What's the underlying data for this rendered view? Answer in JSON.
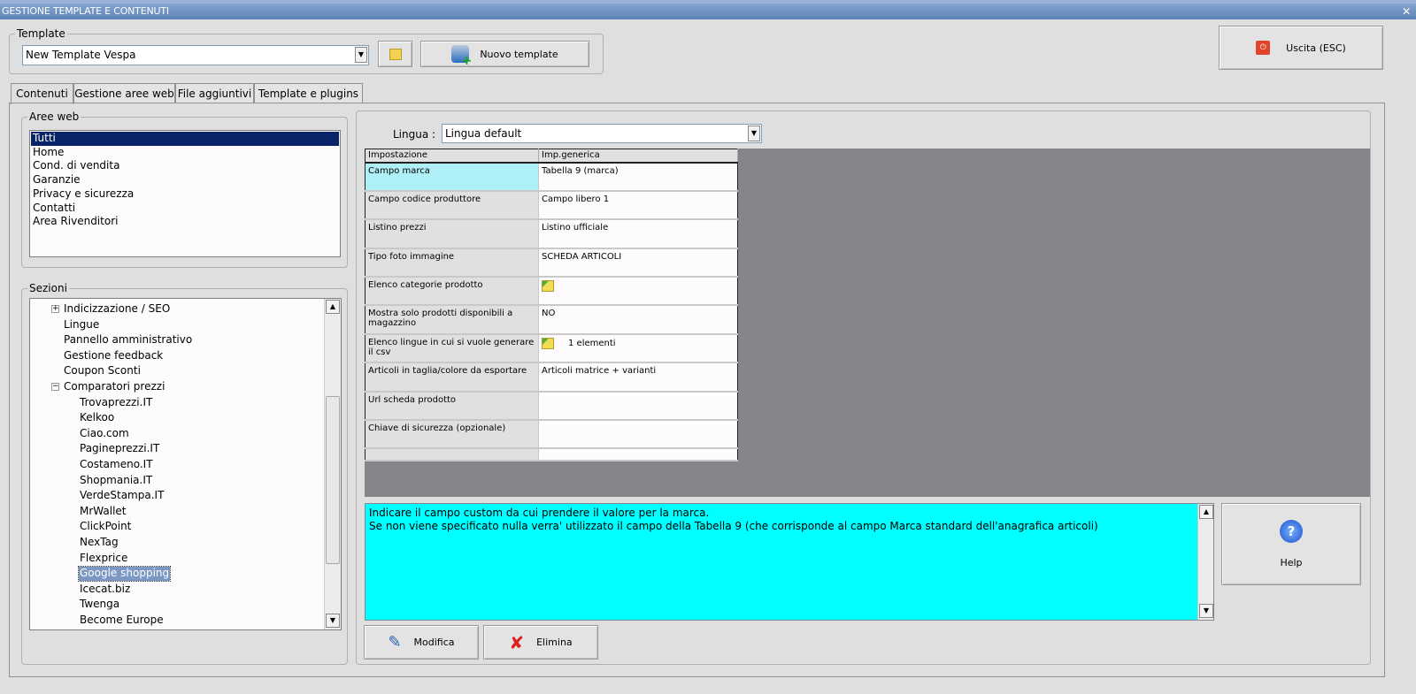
{
  "window": {
    "title": "GESTIONE TEMPLATE E CONTENUTI"
  },
  "template": {
    "group_label": "Template",
    "selected": "New Template Vespa",
    "new_button": "Nuovo template"
  },
  "exit_button": "Uscita (ESC)",
  "tabs": [
    {
      "label": "Contenuti"
    },
    {
      "label": "Gestione aree web"
    },
    {
      "label": "File aggiuntivi"
    },
    {
      "label": "Template e plugins"
    }
  ],
  "aree_web": {
    "label": "Aree web",
    "items": [
      "Tutti",
      "Home",
      "Cond. di vendita",
      "Garanzie",
      "Privacy e sicurezza",
      "Contatti",
      "Area Rivenditori"
    ],
    "selected": "Tutti"
  },
  "sezioni": {
    "label": "Sezioni",
    "items": [
      {
        "label": "Indicizzazione / SEO",
        "level": 1,
        "expander": "+"
      },
      {
        "label": "Lingue",
        "level": 1
      },
      {
        "label": "Pannello amministrativo",
        "level": 1
      },
      {
        "label": "Gestione feedback",
        "level": 1
      },
      {
        "label": "Coupon Sconti",
        "level": 1
      },
      {
        "label": "Comparatori prezzi",
        "level": 1,
        "expander": "−"
      },
      {
        "label": "Trovaprezzi.IT",
        "level": 2
      },
      {
        "label": "Kelkoo",
        "level": 2
      },
      {
        "label": "Ciao.com",
        "level": 2
      },
      {
        "label": "Pagineprezzi.IT",
        "level": 2
      },
      {
        "label": "Costameno.IT",
        "level": 2
      },
      {
        "label": "Shopmania.IT",
        "level": 2
      },
      {
        "label": "VerdeStampa.IT",
        "level": 2
      },
      {
        "label": "MrWallet",
        "level": 2
      },
      {
        "label": "ClickPoint",
        "level": 2
      },
      {
        "label": "NexTag",
        "level": 2
      },
      {
        "label": "Flexprice",
        "level": 2
      },
      {
        "label": "Google shopping",
        "level": 2,
        "selected": true
      },
      {
        "label": "Icecat.biz",
        "level": 2
      },
      {
        "label": "Twenga",
        "level": 2
      },
      {
        "label": "Become Europe",
        "level": 2
      }
    ]
  },
  "lingua": {
    "label": "Lingua :",
    "selected": "Lingua default"
  },
  "grid": {
    "headers": [
      "Impostazione",
      "Imp.generica"
    ],
    "rows": [
      {
        "setting": "Campo marca",
        "value": "Tabella 9 (marca)"
      },
      {
        "setting": "Campo codice produttore",
        "value": "Campo libero 1"
      },
      {
        "setting": "Listino prezzi",
        "value": "Listino ufficiale"
      },
      {
        "setting": "Tipo foto immagine",
        "value": "SCHEDA ARTICOLI"
      },
      {
        "setting": "Elenco categorie prodotto",
        "value": "",
        "icon": "folder-icon"
      },
      {
        "setting": "Mostra solo prodotti disponibili a magazzino",
        "value": "NO"
      },
      {
        "setting": "Elenco lingue in cui si vuole generare il csv",
        "value": "1 elementi",
        "icon": "folder-icon"
      },
      {
        "setting": "Articoli in taglia/colore da esportare",
        "value": "Articoli matrice + varianti"
      },
      {
        "setting": "Url scheda prodotto",
        "value": ""
      },
      {
        "setting": "Chiave di sicurezza (opzionale)",
        "value": ""
      }
    ]
  },
  "description": {
    "line1": "Indicare il campo custom da cui prendere il valore per la marca.",
    "line2": "Se non viene specificato nulla verra' utilizzato il campo della Tabella 9 (che corrisponde al campo Marca standard dell'anagrafica articoli)"
  },
  "buttons": {
    "help": "Help",
    "modifica": "Modifica",
    "elimina": "Elimina"
  },
  "colors": {
    "description_bg": "#00ffff",
    "selected_row": "#aef0f6",
    "grid_bg": "#878589"
  }
}
